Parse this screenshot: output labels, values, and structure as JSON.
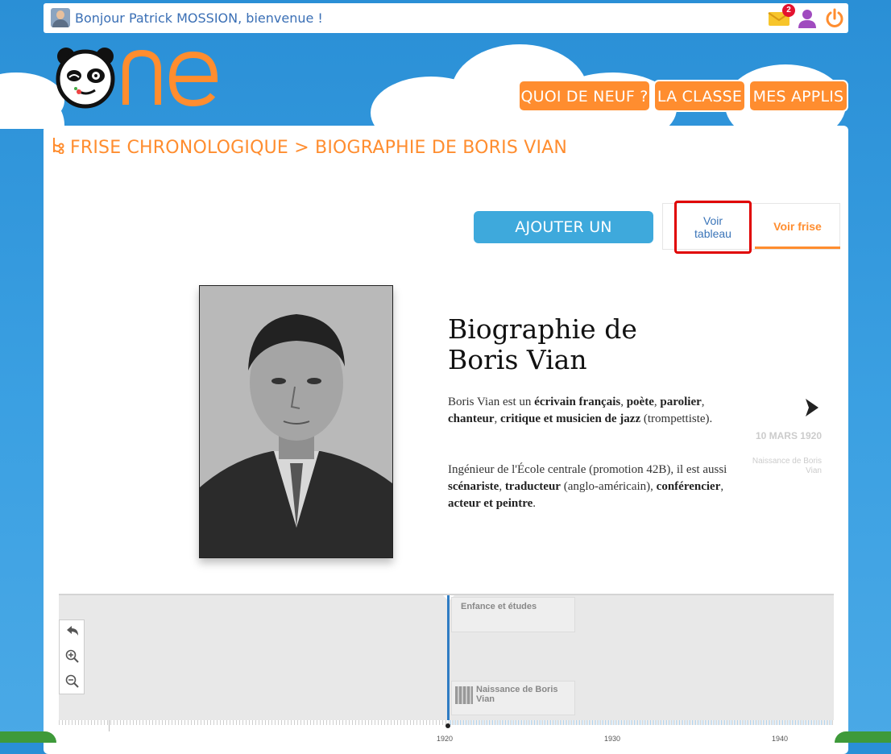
{
  "topbar": {
    "greeting": "Bonjour Patrick MOSSION, bienvenue !",
    "mail_count": "2"
  },
  "nav": {
    "items": [
      {
        "label": "QUOI DE NEUF ?"
      },
      {
        "label": "LA CLASSE"
      },
      {
        "label": "MES APPLIS"
      }
    ]
  },
  "breadcrumb": "FRISE CHRONOLOGIQUE > BIOGRAPHIE DE BORIS VIAN",
  "toolbar": {
    "add_event_label": "AJOUTER UN ÉVÈNEMENT",
    "view_table_label": "Voir tableau",
    "view_frise_label": "Voir frise"
  },
  "bio": {
    "title": "Biographie de Boris Vian",
    "p1_plain1": "Boris Vian est un ",
    "p1_bold1": "écrivain français",
    "p1_plain2": ", ",
    "p1_bold2": "poète",
    "p1_plain3": ", ",
    "p1_bold3": "parolier",
    "p1_plain4": ", ",
    "p1_bold4": "chanteur",
    "p1_plain5": ", ",
    "p1_bold5": "critique et musicien de jazz",
    "p1_plain6": " (trompettiste).",
    "p2_plain1": "Ingénieur de l'École centrale (promotion 42B), il est aussi ",
    "p2_bold1": "scénariste",
    "p2_plain2": ", ",
    "p2_bold2": "traducteur",
    "p2_plain3": " (anglo-américain), ",
    "p2_bold3": "conférencier",
    "p2_plain4": ", ",
    "p2_bold4": "acteur et peintre",
    "p2_plain5": "."
  },
  "next": {
    "date": "10 MARS 1920",
    "description": "Naissance de Boris Vian"
  },
  "timeline": {
    "events": [
      {
        "label": "Enfance et études"
      },
      {
        "label": "Naissance de Boris Vian"
      }
    ],
    "years": [
      "1920",
      "1930",
      "1940"
    ]
  },
  "colors": {
    "brand_orange": "#ff8d2f",
    "brand_blue": "#3ea9dc",
    "highlight_red": "#e00000"
  }
}
